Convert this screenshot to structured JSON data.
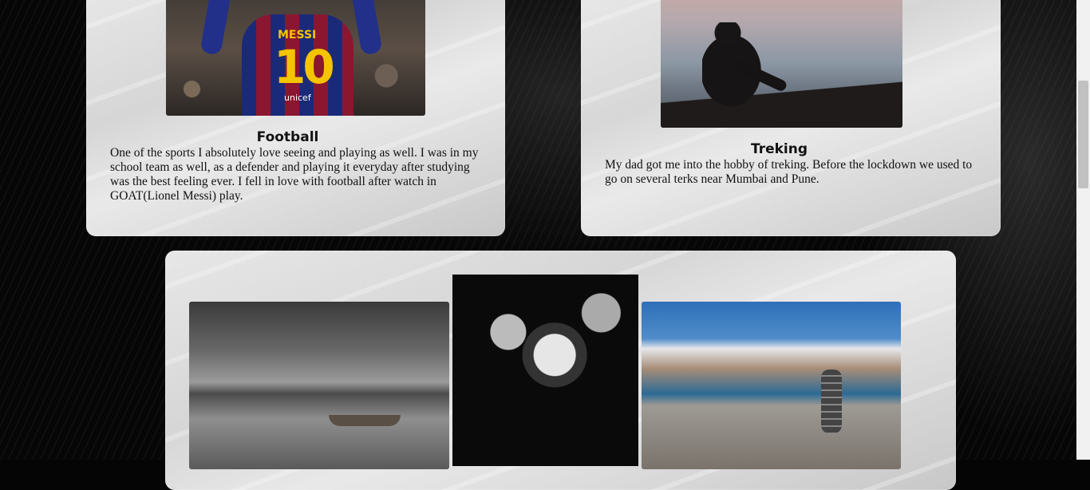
{
  "cards": {
    "football": {
      "title": "Football",
      "text": "One of the sports I absolutely love seeing and playing as well. I was in my school team as well, as a defender and playing it everyday after studying was the best feeling ever. I fell in love with football after watch in GOAT(Lionel Messi) play."
    },
    "treking": {
      "title": "Treking",
      "text": "My dad got me into the hobby of treking. Before the lockdown we used to go on several terks near Mumbai and Pune."
    }
  },
  "photos": {
    "football_jersey_name": "MESSI",
    "football_jersey_number": "10",
    "football_sponsor": "unicef"
  },
  "gallery": {
    "items": [
      "lake-with-boats-photo",
      "sunflowers-photo",
      "stone-stack-photo"
    ]
  }
}
